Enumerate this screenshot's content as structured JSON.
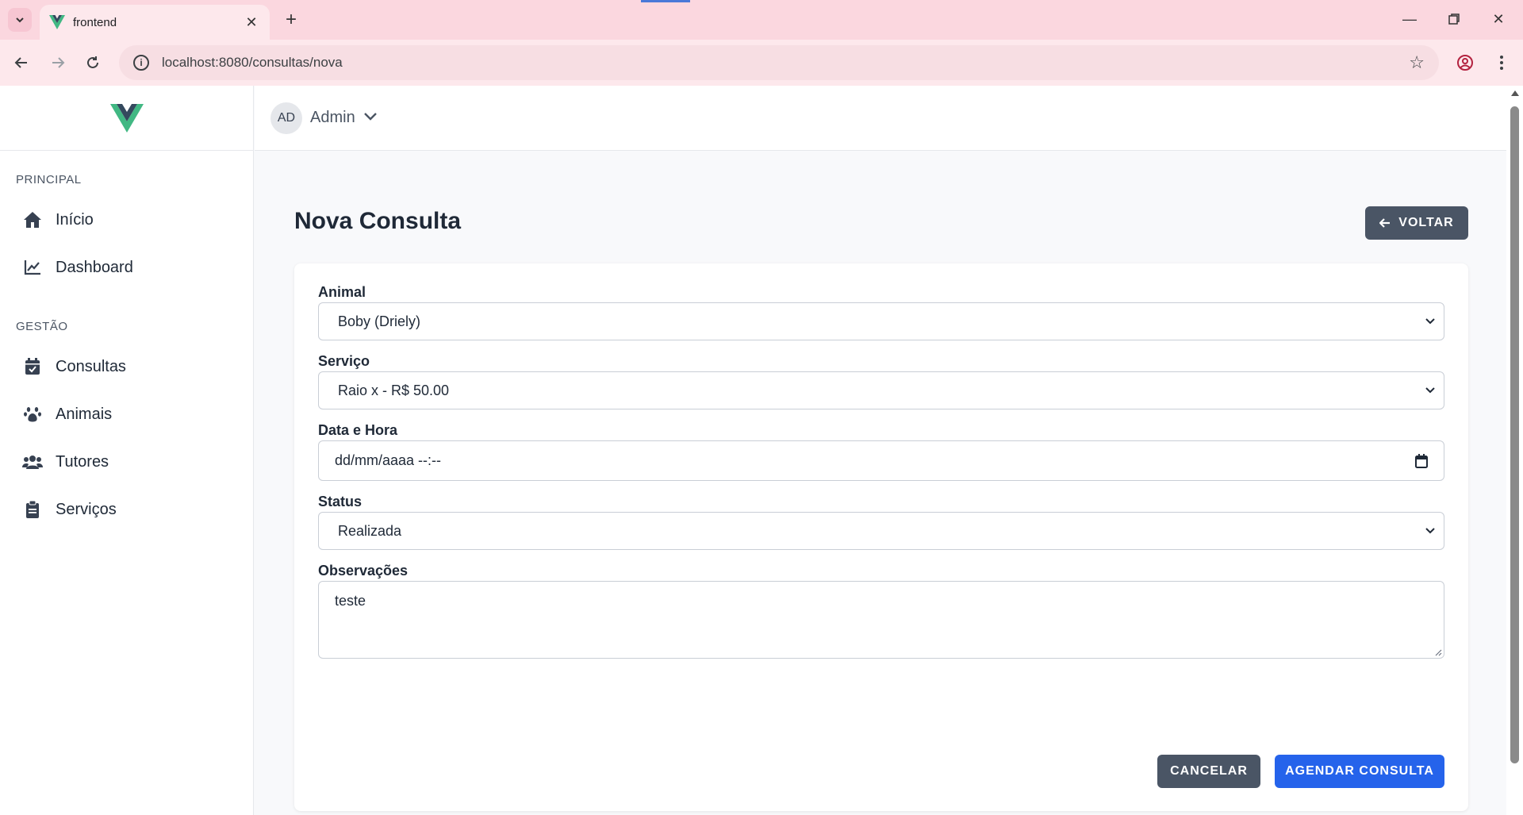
{
  "browser": {
    "tab_title": "frontend",
    "url": "localhost:8080/consultas/nova"
  },
  "sidebar": {
    "sections": [
      {
        "label": "PRINCIPAL",
        "items": [
          {
            "label": "Início",
            "icon": "home-icon"
          },
          {
            "label": "Dashboard",
            "icon": "chart-line-icon"
          }
        ]
      },
      {
        "label": "GESTÃO",
        "items": [
          {
            "label": "Consultas",
            "icon": "calendar-check-icon"
          },
          {
            "label": "Animais",
            "icon": "paw-icon"
          },
          {
            "label": "Tutores",
            "icon": "users-icon"
          },
          {
            "label": "Serviços",
            "icon": "clipboard-icon"
          }
        ]
      }
    ]
  },
  "topbar": {
    "avatar_initials": "AD",
    "user_name": "Admin"
  },
  "page": {
    "title": "Nova Consulta",
    "back_label": "VOLTAR"
  },
  "form": {
    "animal": {
      "label": "Animal",
      "value": "Boby (Driely)"
    },
    "servico": {
      "label": "Serviço",
      "value": "Raio x - R$ 50.00"
    },
    "data_hora": {
      "label": "Data e Hora",
      "placeholder": "dd/mm/aaaa --:--"
    },
    "status": {
      "label": "Status",
      "value": "Realizada"
    },
    "observacoes": {
      "label": "Observações",
      "value": "teste"
    },
    "cancel_label": "CANCELAR",
    "submit_label": "AGENDAR CONSULTA"
  },
  "colors": {
    "primary": "#2563eb",
    "secondary": "#4a5565",
    "brand_green": "#41b883",
    "brand_dark": "#34495e",
    "chrome_pink": "#fbd7df"
  }
}
